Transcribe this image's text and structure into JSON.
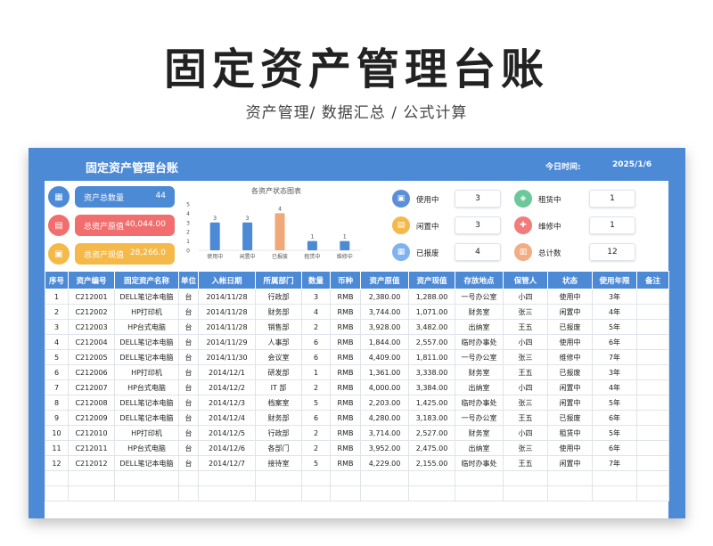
{
  "page": {
    "title": "固定资产管理台账",
    "subtitle": "资产管理/  数据汇总  / 公式计算"
  },
  "sheet": {
    "title": "固定资产管理台账",
    "date_label": "今日时间:",
    "date_value": "2025/1/6"
  },
  "summary": {
    "count_label": "资产总数量",
    "count_value": "44",
    "original_label": "总资产原值",
    "original_value": "40,044.00",
    "current_label": "总资产现值",
    "current_value": "28,266.0"
  },
  "status_panel": {
    "in_use_label": "使用中",
    "in_use_value": "3",
    "idle_label": "闲置中",
    "idle_value": "3",
    "scrapped_label": "已报废",
    "scrapped_value": "4",
    "rented_label": "租赁中",
    "rented_value": "1",
    "repair_label": "维修中",
    "repair_value": "1",
    "total_label": "总计数",
    "total_value": "12"
  },
  "chart_data": {
    "type": "bar",
    "title": "各资产状态图表",
    "categories": [
      "使用中",
      "闲置中",
      "已报废",
      "租赁中",
      "维修中"
    ],
    "values": [
      3,
      3,
      4,
      1,
      1
    ],
    "colors": [
      "#4d8ad6",
      "#4d8ad6",
      "#f0a878",
      "#4d8ad6",
      "#4d8ad6"
    ],
    "ylim": [
      0,
      5
    ],
    "yticks": [
      "0",
      "1",
      "2",
      "3",
      "4",
      "5"
    ],
    "xlabel": "",
    "ylabel": ""
  },
  "colors": {
    "accent": "#4d8ad6",
    "count_pill": "#4d8ad6",
    "original_pill": "#f26d6d",
    "current_pill": "#f5b94a",
    "icon_blue": "#5b8fd8",
    "icon_yellow": "#f5b94a",
    "icon_lightblue": "#7fb2ef",
    "icon_green": "#6cc79a",
    "icon_red": "#f07c7c",
    "icon_orange": "#f3ad84"
  },
  "table": {
    "headers": [
      "序号",
      "资产编号",
      "固定资产名称",
      "单位",
      "入帐日期",
      "所属部门",
      "数量",
      "币种",
      "资产原值",
      "资产现值",
      "存放地点",
      "保管人",
      "状态",
      "使用年限",
      "备注"
    ],
    "rows": [
      [
        "1",
        "C212001",
        "DELL笔记本电脑",
        "台",
        "2014/11/28",
        "行政部",
        "3",
        "RMB",
        "2,380.00",
        "1,288.00",
        "一号办公室",
        "小四",
        "使用中",
        "3年",
        ""
      ],
      [
        "2",
        "C212002",
        "HP打印机",
        "台",
        "2014/11/28",
        "财务部",
        "4",
        "RMB",
        "3,744.00",
        "1,071.00",
        "财务室",
        "张三",
        "闲置中",
        "4年",
        ""
      ],
      [
        "3",
        "C212003",
        "HP台式电脑",
        "台",
        "2014/11/28",
        "销售部",
        "2",
        "RMB",
        "3,928.00",
        "3,482.00",
        "出纳室",
        "王五",
        "已报废",
        "5年",
        ""
      ],
      [
        "4",
        "C212004",
        "DELL笔记本电脑",
        "台",
        "2014/11/29",
        "人事部",
        "6",
        "RMB",
        "1,844.00",
        "2,557.00",
        "临时办事处",
        "小四",
        "使用中",
        "6年",
        ""
      ],
      [
        "5",
        "C212005",
        "DELL笔记本电脑",
        "台",
        "2014/11/30",
        "会议室",
        "6",
        "RMB",
        "4,409.00",
        "1,811.00",
        "一号办公室",
        "张三",
        "维修中",
        "7年",
        ""
      ],
      [
        "6",
        "C212006",
        "HP打印机",
        "台",
        "2014/12/1",
        "研发部",
        "1",
        "RMB",
        "1,361.00",
        "3,338.00",
        "财务室",
        "王五",
        "已报废",
        "3年",
        ""
      ],
      [
        "7",
        "C212007",
        "HP台式电脑",
        "台",
        "2014/12/2",
        "IT 部",
        "2",
        "RMB",
        "4,000.00",
        "3,384.00",
        "出纳室",
        "小四",
        "闲置中",
        "4年",
        ""
      ],
      [
        "8",
        "C212008",
        "DELL笔记本电脑",
        "台",
        "2014/12/3",
        "档案室",
        "5",
        "RMB",
        "2,203.00",
        "1,425.00",
        "临时办事处",
        "张三",
        "闲置中",
        "5年",
        ""
      ],
      [
        "9",
        "C212009",
        "DELL笔记本电脑",
        "台",
        "2014/12/4",
        "财务部",
        "6",
        "RMB",
        "4,280.00",
        "3,183.00",
        "一号办公室",
        "王五",
        "已报废",
        "6年",
        ""
      ],
      [
        "10",
        "C212010",
        "HP打印机",
        "台",
        "2014/12/5",
        "行政部",
        "2",
        "RMB",
        "3,714.00",
        "2,527.00",
        "财务室",
        "小四",
        "租赁中",
        "5年",
        ""
      ],
      [
        "11",
        "C212011",
        "HP台式电脑",
        "台",
        "2014/12/6",
        "各部门",
        "2",
        "RMB",
        "3,952.00",
        "2,475.00",
        "出纳室",
        "张三",
        "使用中",
        "6年",
        ""
      ],
      [
        "12",
        "C212012",
        "DELL笔记本电脑",
        "台",
        "2014/12/7",
        "接待室",
        "5",
        "RMB",
        "4,229.00",
        "2,155.00",
        "临时办事处",
        "王五",
        "闲置中",
        "7年",
        ""
      ]
    ],
    "empty_rows": 2
  }
}
